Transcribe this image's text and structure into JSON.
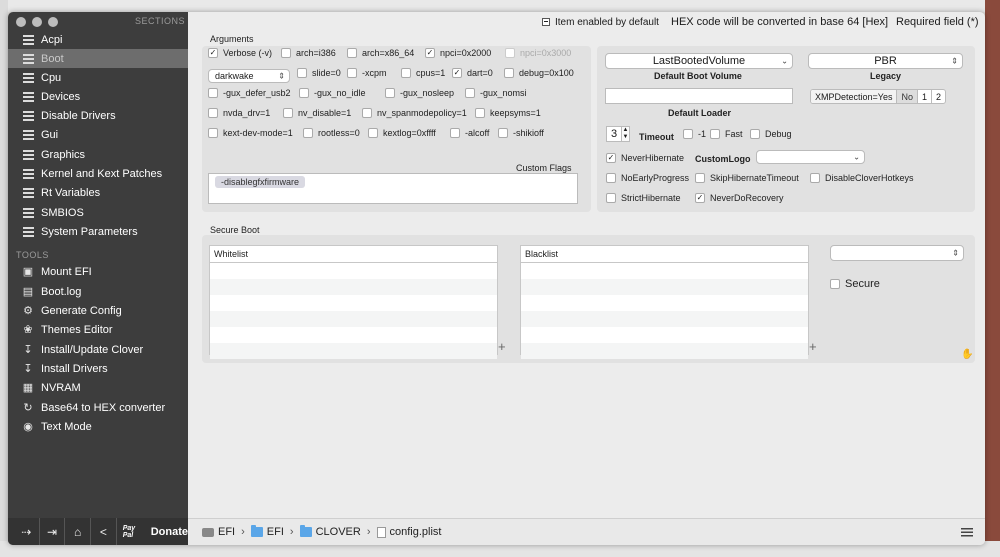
{
  "topbar": {
    "legend_label": "Item enabled by default",
    "hex_note": "HEX code will be converted in base 64 [Hex]",
    "required_note": "Required field (*)"
  },
  "sidebar": {
    "sections_header": "SECTIONS",
    "tools_header": "TOOLS",
    "sections": [
      {
        "label": "Acpi",
        "icon": "grid-icon"
      },
      {
        "label": "Boot",
        "icon": "grid-icon",
        "active": true
      },
      {
        "label": "Cpu",
        "icon": "grid-icon"
      },
      {
        "label": "Devices",
        "icon": "grid-icon"
      },
      {
        "label": "Disable Drivers",
        "icon": "grid-icon"
      },
      {
        "label": "Gui",
        "icon": "grid-icon"
      },
      {
        "label": "Graphics",
        "icon": "grid-icon"
      },
      {
        "label": "Kernel and Kext Patches",
        "icon": "grid-icon"
      },
      {
        "label": "Rt Variables",
        "icon": "grid-icon"
      },
      {
        "label": "SMBIOS",
        "icon": "grid-icon"
      },
      {
        "label": "System Parameters",
        "icon": "grid-icon"
      }
    ],
    "tools": [
      {
        "label": "Mount EFI",
        "icon": "disk-icon"
      },
      {
        "label": "Boot.log",
        "icon": "document-icon"
      },
      {
        "label": "Generate Config",
        "icon": "gear-icon"
      },
      {
        "label": "Themes Editor",
        "icon": "palette-icon"
      },
      {
        "label": "Install/Update Clover",
        "icon": "download-icon"
      },
      {
        "label": "Install Drivers",
        "icon": "download-icon"
      },
      {
        "label": "NVRAM",
        "icon": "chip-icon"
      },
      {
        "label": "Base64 to HEX converter",
        "icon": "refresh-icon"
      },
      {
        "label": "Text Mode",
        "icon": "eye-icon"
      }
    ],
    "donate_label": "Donate",
    "paypal_text": "Pay Pal"
  },
  "arguments": {
    "title": "Arguments",
    "checkboxes": [
      {
        "label": "Verbose (-v)",
        "checked": true
      },
      {
        "label": "arch=i386",
        "checked": false
      },
      {
        "label": "arch=x86_64",
        "checked": false
      },
      {
        "label": "npci=0x2000",
        "checked": true
      },
      {
        "label": "npci=0x3000",
        "checked": false,
        "disabled": true
      },
      {
        "label": "slide=0",
        "checked": false
      },
      {
        "label": "-xcpm",
        "checked": false
      },
      {
        "label": "cpus=1",
        "checked": false
      },
      {
        "label": "dart=0",
        "checked": true
      },
      {
        "label": "debug=0x100",
        "checked": false
      },
      {
        "label": "-gux_defer_usb2",
        "checked": false
      },
      {
        "label": "-gux_no_idle",
        "checked": false
      },
      {
        "label": "-gux_nosleep",
        "checked": false
      },
      {
        "label": "-gux_nomsi",
        "checked": false
      },
      {
        "label": "nvda_drv=1",
        "checked": false
      },
      {
        "label": "nv_disable=1",
        "checked": false
      },
      {
        "label": "nv_spanmodepolicy=1",
        "checked": false
      },
      {
        "label": "keepsyms=1",
        "checked": false
      },
      {
        "label": "kext-dev-mode=1",
        "checked": false
      },
      {
        "label": "rootless=0",
        "checked": false
      },
      {
        "label": "kextlog=0xffff",
        "checked": false
      },
      {
        "label": "-alcoff",
        "checked": false
      },
      {
        "label": "-shikioff",
        "checked": false
      }
    ],
    "darkwake_value": "darkwake",
    "custom_flags_label": "Custom Flags",
    "custom_flags_value": "-disablegfxfirmware"
  },
  "boot": {
    "default_volume_value": "LastBootedVolume",
    "default_volume_label": "Default Boot Volume",
    "legacy_value": "PBR",
    "legacy_label": "Legacy",
    "default_loader_label": "Default Loader",
    "default_loader_value": "",
    "xmp_label": "XMPDetection=Yes",
    "xmp_options": [
      "No",
      "1",
      "2"
    ],
    "timeout_value": "3",
    "timeout_label": "Timeout",
    "minus_one_label": "-1",
    "fast_label": "Fast",
    "debug_label": "Debug",
    "never_hibernate_label": "NeverHibernate",
    "custom_logo_label": "CustomLogo",
    "no_early_progress_label": "NoEarlyProgress",
    "skip_hibernate_timeout_label": "SkipHibernateTimeout",
    "disable_clover_hotkeys_label": "DisableCloverHotkeys",
    "strict_hibernate_label": "StrictHibernate",
    "never_do_recovery_label": "NeverDoRecovery"
  },
  "secure_boot": {
    "title": "Secure Boot",
    "whitelist_header": "Whitelist",
    "blacklist_header": "Blacklist",
    "secure_label": "Secure",
    "policy_value": ""
  },
  "pathbar": {
    "segments": [
      "EFI",
      "EFI",
      "CLOVER",
      "config.plist"
    ]
  }
}
